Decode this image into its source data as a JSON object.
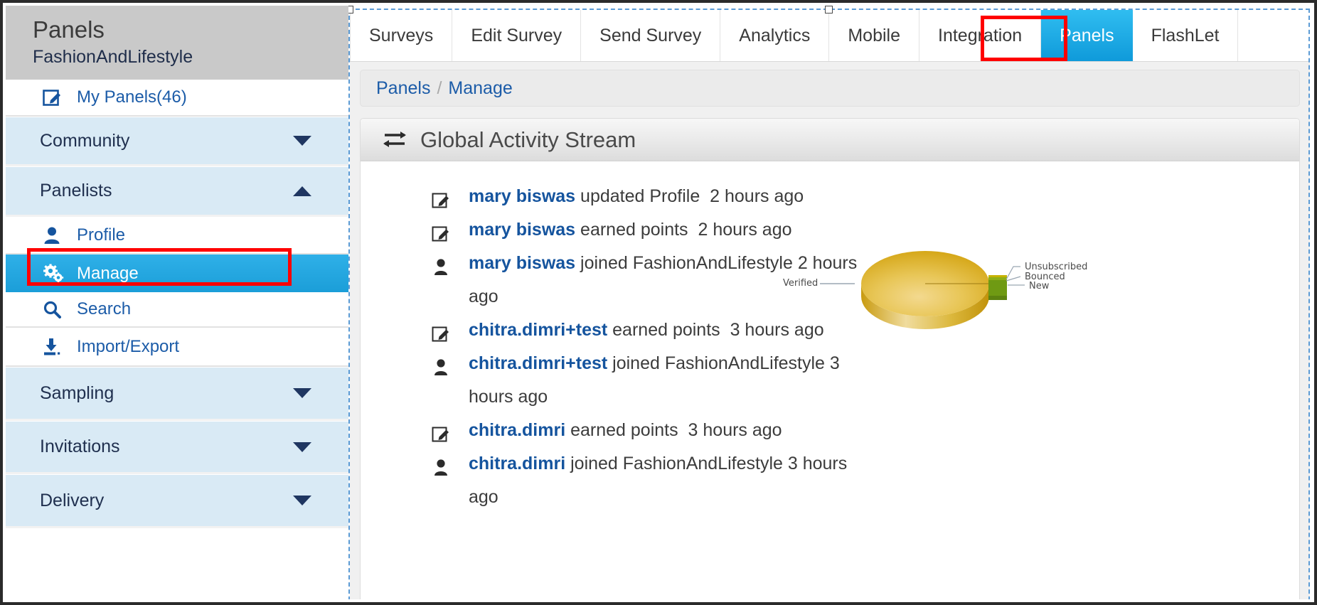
{
  "sidebar": {
    "title": "Panels",
    "subtitle": "FashionAndLifestyle",
    "my_panels": "My Panels(46)",
    "groups": {
      "community": "Community",
      "panelists": "Panelists",
      "sampling": "Sampling",
      "invitations": "Invitations",
      "delivery": "Delivery"
    },
    "panelist_items": {
      "profile": "Profile",
      "manage": "Manage",
      "search": "Search",
      "import_export": "Import/Export"
    },
    "active_item": "Manage",
    "highlight_color": "#ff0000",
    "active_bg_color": "#1b9ed8"
  },
  "tabs": [
    {
      "label": "Surveys",
      "active": false
    },
    {
      "label": "Edit Survey",
      "active": false
    },
    {
      "label": "Send Survey",
      "active": false
    },
    {
      "label": "Analytics",
      "active": false
    },
    {
      "label": "Mobile",
      "active": false
    },
    {
      "label": "Integration",
      "active": false
    },
    {
      "label": "Panels",
      "active": true
    },
    {
      "label": "FlashLet",
      "active": false
    }
  ],
  "breadcrumb": {
    "root": "Panels",
    "separator": "/",
    "current": "Manage"
  },
  "panel": {
    "heading": "Global Activity Stream",
    "heading_icon": "exchange-arrows-icon"
  },
  "activity": [
    {
      "icon": "pencil-square-icon",
      "user": "mary biswas",
      "text": "updated Profile",
      "time": "2 hours ago"
    },
    {
      "icon": "pencil-square-icon",
      "user": "mary biswas",
      "text": "earned points",
      "time": "2 hours ago"
    },
    {
      "icon": "person-icon",
      "user": "mary biswas",
      "text": "joined FashionAndLifestyle",
      "time": "2 hours ago"
    },
    {
      "icon": "pencil-square-icon",
      "user": "chitra.dimri+test",
      "text": "earned points",
      "time": "3 hours ago"
    },
    {
      "icon": "person-icon",
      "user": "chitra.dimri+test",
      "text": "joined FashionAndLifestyle",
      "time": "3 hours ago"
    },
    {
      "icon": "pencil-square-icon",
      "user": "chitra.dimri",
      "text": "earned points",
      "time": "3 hours ago"
    },
    {
      "icon": "person-icon",
      "user": "chitra.dimri",
      "text": "joined FashionAndLifestyle",
      "time": "3 hours ago"
    }
  ],
  "chart_data": {
    "type": "pie",
    "title": "",
    "labels": [
      "Verified",
      "Unsubscribed",
      "Bounced",
      "New"
    ],
    "values": [
      96,
      0.6,
      0.6,
      2.8
    ],
    "colors": [
      "#d9a81f",
      "#c7b200",
      "#8fae17",
      "#6f9a13"
    ],
    "legend": "callout-labels",
    "three_d": true,
    "label_positions": {
      "Verified": "left",
      "Unsubscribed": "right",
      "Bounced": "right",
      "New": "right"
    }
  }
}
